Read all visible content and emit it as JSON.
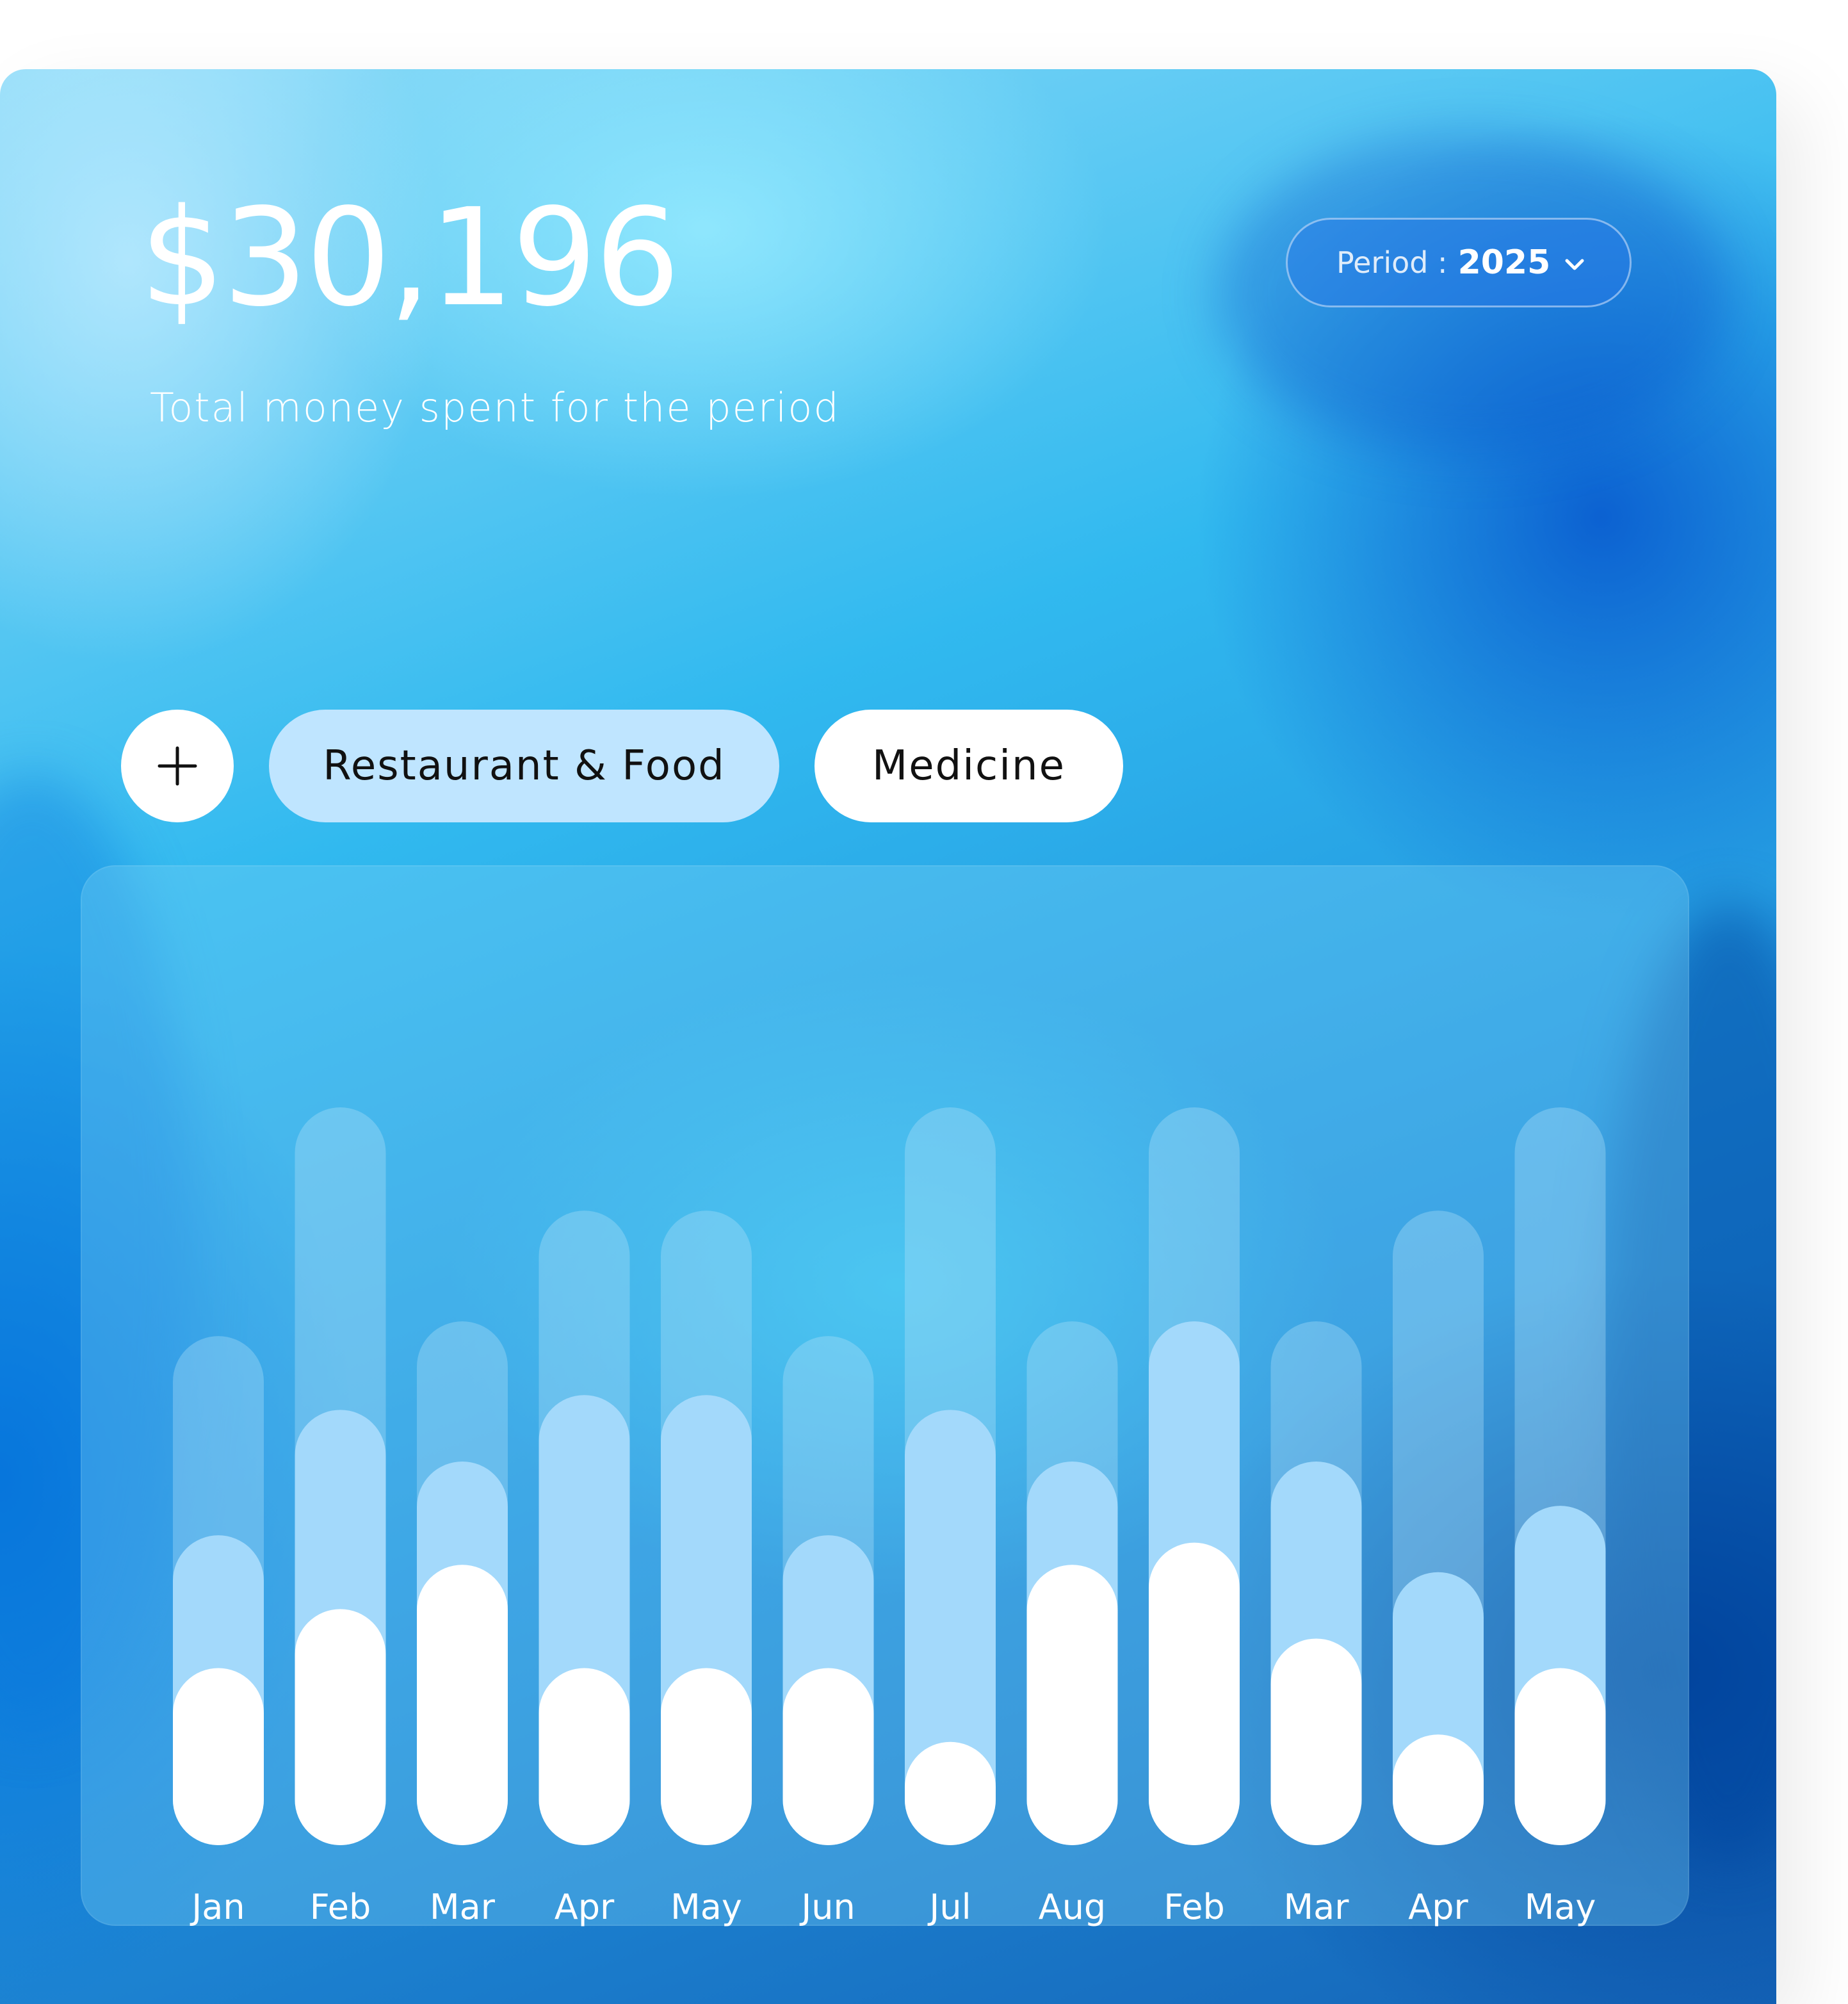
{
  "header": {
    "total_amount": "$30,196",
    "subtitle": "Total money spent for the period"
  },
  "period": {
    "label": "Period :",
    "value": "2025",
    "icon": "chevron-down-icon"
  },
  "filters": {
    "add_icon": "plus-icon",
    "chips": [
      {
        "label": "Restaurant & Food",
        "selected": true,
        "color": "#bfe5ff"
      },
      {
        "label": "Medicine",
        "selected": false,
        "color": "#ffffff"
      }
    ]
  },
  "colors": {
    "background_layer": "rgba(180,225,250,0.35)",
    "middle_layer": "#a3d9fb",
    "front_layer": "#ffffff",
    "text": "#ffffff"
  },
  "chart_data": {
    "type": "bar",
    "categories": [
      "Jan",
      "Feb",
      "Mar",
      "Apr",
      "May",
      "Jun",
      "Jul",
      "Aug",
      "Feb",
      "Mar",
      "Apr",
      "May"
    ],
    "series": [
      {
        "values": [
          0.69,
          1.0,
          0.71,
          0.86,
          0.86,
          0.69,
          1.0,
          0.71,
          1.0,
          0.71,
          0.86,
          1.0
        ]
      },
      {
        "values": [
          0.42,
          0.59,
          0.52,
          0.61,
          0.61,
          0.42,
          0.59,
          0.52,
          0.71,
          0.52,
          0.37,
          0.46
        ]
      },
      {
        "values": [
          0.24,
          0.32,
          0.38,
          0.24,
          0.24,
          0.24,
          0.14,
          0.38,
          0.41,
          0.28,
          0.15,
          0.24
        ]
      }
    ],
    "ylim": [
      0,
      1
    ],
    "grid": false,
    "legend": "none"
  }
}
